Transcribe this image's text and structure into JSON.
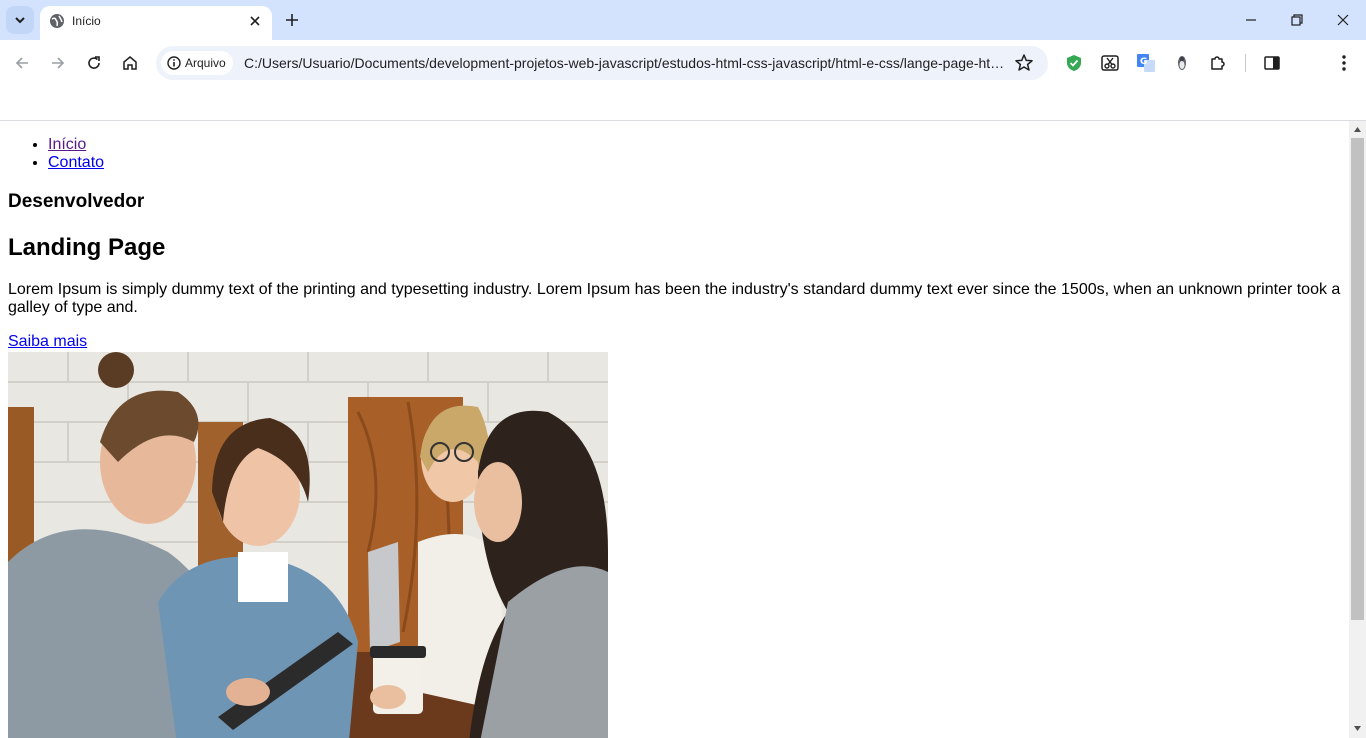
{
  "browser": {
    "tab": {
      "title": "Início"
    },
    "address_bar": {
      "security_chip": "Arquivo",
      "url": "C:/Users/Usuario/Documents/development-projetos-web-javascript/estudos-html-css-javascript/html-e-css/lange-page-html/index.html"
    },
    "icons": [
      "tab-search-icon",
      "globe-icon",
      "close-icon",
      "plus-icon",
      "minimize-icon",
      "restore-icon",
      "back-icon",
      "forward-icon",
      "reload-icon",
      "home-icon",
      "info-icon",
      "star-icon",
      "shield-icon",
      "scissors-icon",
      "translate-icon",
      "profile-icon",
      "puzzle-icon",
      "side-panel-icon",
      "kebab-menu-icon"
    ]
  },
  "page": {
    "nav": [
      "Início",
      "Contato"
    ],
    "kicker": "Desenvolvedor",
    "title": "Landing Page",
    "lede": "Lorem Ipsum is simply dummy text of the printing and typesetting industry. Lorem Ipsum has been the industry's standard dummy text ever since the 1500s, when an unknown printer took a galley of type and.",
    "cta": "Saiba mais"
  },
  "colors": {
    "tabstrip": "#d3e3fd",
    "omnibox": "#eef2fa",
    "link": "#0000ee",
    "visited_link": "#551a8b"
  }
}
